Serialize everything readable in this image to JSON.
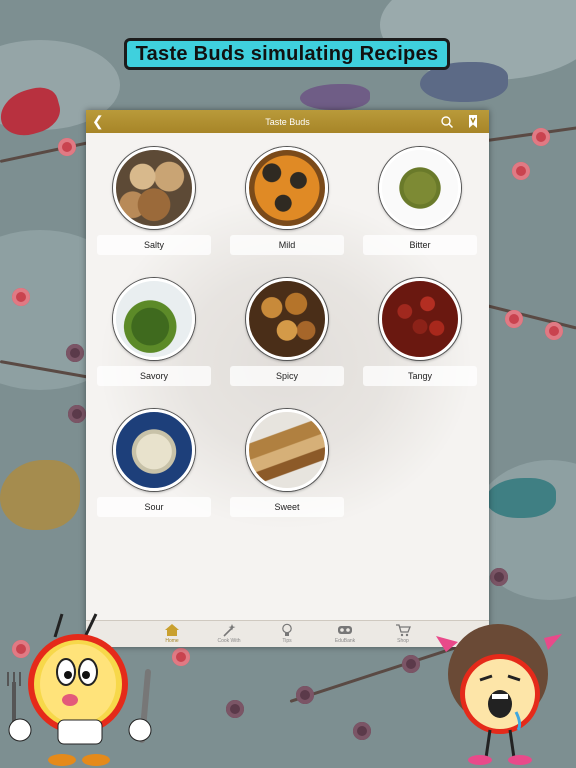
{
  "banner": {
    "title": "Taste Buds simulating Recipes"
  },
  "app": {
    "topbar": {
      "title": "Taste Buds",
      "back_icon": "chevron-left-icon",
      "search_icon": "search-icon",
      "fav_icon": "bookmark-icon"
    },
    "categories": [
      {
        "label": "Salty",
        "image": "roasted-garlic"
      },
      {
        "label": "Mild",
        "image": "stuffed-squash"
      },
      {
        "label": "Bitter",
        "image": "dried-herbs"
      },
      {
        "label": "Savory",
        "image": "green-vegetables"
      },
      {
        "label": "Spicy",
        "image": "roasted-potatoes"
      },
      {
        "label": "Tangy",
        "image": "red-beans"
      },
      {
        "label": "Sour",
        "image": "sliced-onions"
      },
      {
        "label": "Sweet",
        "image": "cake-slice"
      }
    ],
    "tabs": [
      {
        "label": "Home",
        "icon": "home-icon",
        "active": true
      },
      {
        "label": "Cook With",
        "icon": "magic-wand-icon",
        "active": false
      },
      {
        "label": "Tips",
        "icon": "lightbulb-icon",
        "active": false
      },
      {
        "label": "EduBank",
        "icon": "mask-icon",
        "active": false
      },
      {
        "label": "Shop",
        "icon": "cart-icon",
        "active": false
      }
    ]
  },
  "colors": {
    "accent": "#a58423",
    "banner": "#3fd0dd",
    "background": "#7d8f91"
  }
}
